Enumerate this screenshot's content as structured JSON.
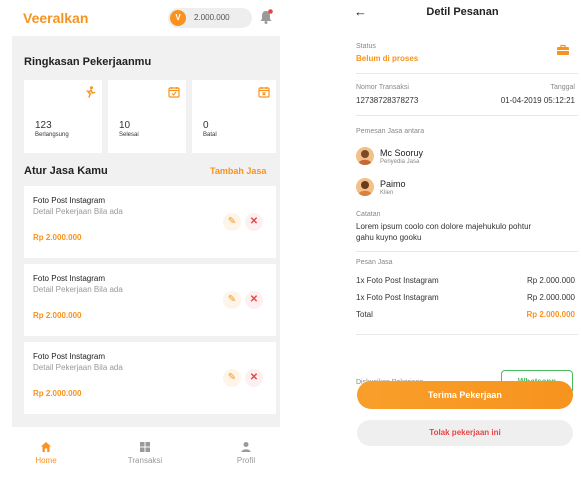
{
  "left": {
    "brand": "Veeralkan",
    "wallet": {
      "badge": "V",
      "amount": "2.000.000"
    },
    "summary_title": "Ringkasan Pekerjaanmu",
    "stats": [
      {
        "value": "123",
        "label": "Berlangsung"
      },
      {
        "value": "10",
        "label": "Selesai"
      },
      {
        "value": "0",
        "label": "Batal"
      }
    ],
    "services_title": "Atur Jasa Kamu",
    "add_service": "Tambah Jasa",
    "services": [
      {
        "title": "Foto Post Instagram",
        "desc": "Detail Pekerjaan Bila ada",
        "price": "Rp 2.000.000"
      },
      {
        "title": "Foto Post Instagram",
        "desc": "Detail Pekerjaan Bila ada",
        "price": "Rp 2.000.000"
      },
      {
        "title": "Foto Post Instagram",
        "desc": "Detail Pekerjaan Bila ada",
        "price": "Rp 2.000.000"
      }
    ],
    "nav": [
      {
        "label": "Home"
      },
      {
        "label": "Transaksi"
      },
      {
        "label": "Profil"
      }
    ]
  },
  "right": {
    "title": "Detil Pesanan",
    "status_label": "Status",
    "status_value": "Belum di proses",
    "trx_label": "Nomor Transaksi",
    "trx_value": "12738728378273",
    "date_label": "Tanggal",
    "date_value": "01-04-2019 05:12:21",
    "parties_label": "Pemesan Jasa antara",
    "provider": {
      "name": "Mc Sooruy",
      "role": "Penyedia Jasa"
    },
    "client": {
      "name": "Paimo",
      "role": "Klien"
    },
    "note_label": "Catatan",
    "note_line1": "Lorem ipsum coolo con dolore majehukulo pohtur",
    "note_line2": "gahu kuyno gooku",
    "order_label": "Pesan Jasa",
    "items": [
      {
        "name": "1x Foto Post Instagram",
        "price": "Rp 2.000.000"
      },
      {
        "name": "1x Foto Post Instagram",
        "price": "Rp 2.000.000"
      }
    ],
    "total_label": "Total",
    "total_value": "Rp 2.000.000",
    "discuss_label": "Diskusikan Pekerjaan",
    "whatsapp": "Whatsapp",
    "accept": "Terima Pekerjaan",
    "reject": "Tolak pekerjaan ini"
  },
  "colors": {
    "accent": "#f7931e",
    "danger": "#e84545",
    "success": "#4cbb5d"
  }
}
